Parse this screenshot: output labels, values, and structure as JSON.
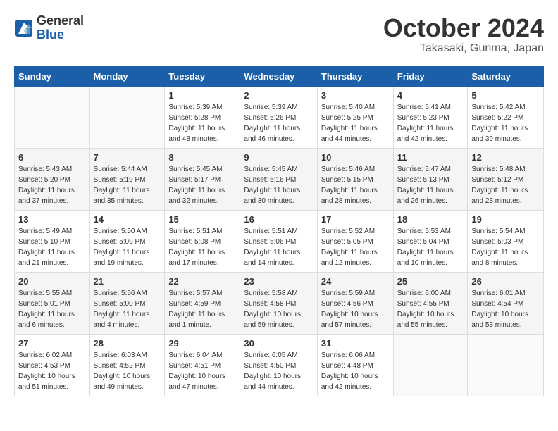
{
  "header": {
    "logo_general": "General",
    "logo_blue": "Blue",
    "title": "October 2024",
    "subtitle": "Takasaki, Gunma, Japan"
  },
  "days_of_week": [
    "Sunday",
    "Monday",
    "Tuesday",
    "Wednesday",
    "Thursday",
    "Friday",
    "Saturday"
  ],
  "weeks": [
    [
      {
        "day": "",
        "info": ""
      },
      {
        "day": "",
        "info": ""
      },
      {
        "day": "1",
        "info": "Sunrise: 5:39 AM\nSunset: 5:28 PM\nDaylight: 11 hours and 48 minutes."
      },
      {
        "day": "2",
        "info": "Sunrise: 5:39 AM\nSunset: 5:26 PM\nDaylight: 11 hours and 46 minutes."
      },
      {
        "day": "3",
        "info": "Sunrise: 5:40 AM\nSunset: 5:25 PM\nDaylight: 11 hours and 44 minutes."
      },
      {
        "day": "4",
        "info": "Sunrise: 5:41 AM\nSunset: 5:23 PM\nDaylight: 11 hours and 42 minutes."
      },
      {
        "day": "5",
        "info": "Sunrise: 5:42 AM\nSunset: 5:22 PM\nDaylight: 11 hours and 39 minutes."
      }
    ],
    [
      {
        "day": "6",
        "info": "Sunrise: 5:43 AM\nSunset: 5:20 PM\nDaylight: 11 hours and 37 minutes."
      },
      {
        "day": "7",
        "info": "Sunrise: 5:44 AM\nSunset: 5:19 PM\nDaylight: 11 hours and 35 minutes."
      },
      {
        "day": "8",
        "info": "Sunrise: 5:45 AM\nSunset: 5:17 PM\nDaylight: 11 hours and 32 minutes."
      },
      {
        "day": "9",
        "info": "Sunrise: 5:45 AM\nSunset: 5:16 PM\nDaylight: 11 hours and 30 minutes."
      },
      {
        "day": "10",
        "info": "Sunrise: 5:46 AM\nSunset: 5:15 PM\nDaylight: 11 hours and 28 minutes."
      },
      {
        "day": "11",
        "info": "Sunrise: 5:47 AM\nSunset: 5:13 PM\nDaylight: 11 hours and 26 minutes."
      },
      {
        "day": "12",
        "info": "Sunrise: 5:48 AM\nSunset: 5:12 PM\nDaylight: 11 hours and 23 minutes."
      }
    ],
    [
      {
        "day": "13",
        "info": "Sunrise: 5:49 AM\nSunset: 5:10 PM\nDaylight: 11 hours and 21 minutes."
      },
      {
        "day": "14",
        "info": "Sunrise: 5:50 AM\nSunset: 5:09 PM\nDaylight: 11 hours and 19 minutes."
      },
      {
        "day": "15",
        "info": "Sunrise: 5:51 AM\nSunset: 5:08 PM\nDaylight: 11 hours and 17 minutes."
      },
      {
        "day": "16",
        "info": "Sunrise: 5:51 AM\nSunset: 5:06 PM\nDaylight: 11 hours and 14 minutes."
      },
      {
        "day": "17",
        "info": "Sunrise: 5:52 AM\nSunset: 5:05 PM\nDaylight: 11 hours and 12 minutes."
      },
      {
        "day": "18",
        "info": "Sunrise: 5:53 AM\nSunset: 5:04 PM\nDaylight: 11 hours and 10 minutes."
      },
      {
        "day": "19",
        "info": "Sunrise: 5:54 AM\nSunset: 5:03 PM\nDaylight: 11 hours and 8 minutes."
      }
    ],
    [
      {
        "day": "20",
        "info": "Sunrise: 5:55 AM\nSunset: 5:01 PM\nDaylight: 11 hours and 6 minutes."
      },
      {
        "day": "21",
        "info": "Sunrise: 5:56 AM\nSunset: 5:00 PM\nDaylight: 11 hours and 4 minutes."
      },
      {
        "day": "22",
        "info": "Sunrise: 5:57 AM\nSunset: 4:59 PM\nDaylight: 11 hours and 1 minute."
      },
      {
        "day": "23",
        "info": "Sunrise: 5:58 AM\nSunset: 4:58 PM\nDaylight: 10 hours and 59 minutes."
      },
      {
        "day": "24",
        "info": "Sunrise: 5:59 AM\nSunset: 4:56 PM\nDaylight: 10 hours and 57 minutes."
      },
      {
        "day": "25",
        "info": "Sunrise: 6:00 AM\nSunset: 4:55 PM\nDaylight: 10 hours and 55 minutes."
      },
      {
        "day": "26",
        "info": "Sunrise: 6:01 AM\nSunset: 4:54 PM\nDaylight: 10 hours and 53 minutes."
      }
    ],
    [
      {
        "day": "27",
        "info": "Sunrise: 6:02 AM\nSunset: 4:53 PM\nDaylight: 10 hours and 51 minutes."
      },
      {
        "day": "28",
        "info": "Sunrise: 6:03 AM\nSunset: 4:52 PM\nDaylight: 10 hours and 49 minutes."
      },
      {
        "day": "29",
        "info": "Sunrise: 6:04 AM\nSunset: 4:51 PM\nDaylight: 10 hours and 47 minutes."
      },
      {
        "day": "30",
        "info": "Sunrise: 6:05 AM\nSunset: 4:50 PM\nDaylight: 10 hours and 44 minutes."
      },
      {
        "day": "31",
        "info": "Sunrise: 6:06 AM\nSunset: 4:48 PM\nDaylight: 10 hours and 42 minutes."
      },
      {
        "day": "",
        "info": ""
      },
      {
        "day": "",
        "info": ""
      }
    ]
  ]
}
